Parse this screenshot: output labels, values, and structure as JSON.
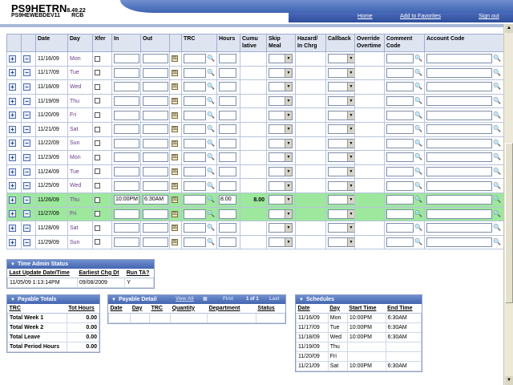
{
  "header": {
    "title": "PS9HETRN",
    "version": "8.49.22",
    "db": "PS9HEWEBDEV11",
    "user": "RCB",
    "links": {
      "home": "Home",
      "favorites": "Add to Favorites",
      "signout": "Sign out"
    }
  },
  "timesheet": {
    "columns": {
      "date": "Date",
      "day": "Day",
      "xfer": "Xfer",
      "in": "In",
      "out": "Out",
      "trc": "TRC",
      "hours": "Hours",
      "cumulative": "Cumu lative",
      "skip_meal": "Skip Meal",
      "hazard": "Hazard/ In Chrg",
      "callback": "Callback",
      "override": "Override Overtime",
      "comment_code": "Comment Code",
      "account_code": "Account Code"
    },
    "add_glyph": "+",
    "delete_glyph": "−",
    "rows": [
      {
        "date": "11/16/09",
        "day": "Mon",
        "in": "",
        "out": "",
        "trc": "",
        "hours": "",
        "cumulative": ""
      },
      {
        "date": "11/17/09",
        "day": "Tue",
        "in": "",
        "out": "",
        "trc": "",
        "hours": "",
        "cumulative": ""
      },
      {
        "date": "11/18/09",
        "day": "Wed",
        "in": "",
        "out": "",
        "trc": "",
        "hours": "",
        "cumulative": ""
      },
      {
        "date": "11/19/09",
        "day": "Thu",
        "in": "",
        "out": "",
        "trc": "",
        "hours": "",
        "cumulative": ""
      },
      {
        "date": "11/20/09",
        "day": "Fri",
        "in": "",
        "out": "",
        "trc": "",
        "hours": "",
        "cumulative": ""
      },
      {
        "date": "11/21/09",
        "day": "Sat",
        "in": "",
        "out": "",
        "trc": "",
        "hours": "",
        "cumulative": ""
      },
      {
        "date": "11/22/09",
        "day": "Sun",
        "in": "",
        "out": "",
        "trc": "",
        "hours": "",
        "cumulative": ""
      },
      {
        "date": "11/23/09",
        "day": "Mon",
        "in": "",
        "out": "",
        "trc": "",
        "hours": "",
        "cumulative": ""
      },
      {
        "date": "11/24/09",
        "day": "Tue",
        "in": "",
        "out": "",
        "trc": "",
        "hours": "",
        "cumulative": ""
      },
      {
        "date": "11/25/09",
        "day": "Wed",
        "in": "",
        "out": "",
        "trc": "",
        "hours": "",
        "cumulative": ""
      },
      {
        "date": "11/26/09",
        "day": "Thu",
        "in": "10:00PM",
        "out": "6:30AM",
        "trc": "",
        "hours": "8.00",
        "cumulative": "8.00"
      },
      {
        "date": "11/27/09",
        "day": "Fri",
        "in": "",
        "out": "",
        "trc": "",
        "hours": "",
        "cumulative": ""
      },
      {
        "date": "11/28/09",
        "day": "Sat",
        "in": "",
        "out": "",
        "trc": "",
        "hours": "",
        "cumulative": ""
      },
      {
        "date": "11/29/09",
        "day": "Sun",
        "in": "",
        "out": "",
        "trc": "",
        "hours": "",
        "cumulative": ""
      }
    ]
  },
  "time_admin_status": {
    "title": "Time Admin Status",
    "headers": [
      "Last Update Date/Time",
      "Earliest Chg Dt",
      "Run TA?"
    ],
    "row": [
      "11/05/09  1:13:14PM",
      "09/08/2009",
      "Y"
    ]
  },
  "payable_totals": {
    "title": "Payable Totals",
    "headers": [
      "TRC",
      "Tot Hours"
    ],
    "rows": [
      [
        "Total Week 1",
        "0.00"
      ],
      [
        "Total Week 2",
        "0.00"
      ],
      [
        "Total Leave",
        "0.00"
      ],
      [
        "Total Period Hours",
        "0.00"
      ]
    ]
  },
  "payable_detail": {
    "title": "Payable Detail",
    "view_all": "View All",
    "first": "First",
    "range": "1 of 1",
    "last": "Last",
    "headers": [
      "Date",
      "Day",
      "TRC",
      "Quantity",
      "Department",
      "Status"
    ]
  },
  "schedules": {
    "title": "Schedules",
    "headers": [
      "Date",
      "Day",
      "Start Time",
      "End Time"
    ],
    "rows": [
      [
        "11/16/09",
        "Mon",
        "10:00PM",
        "6:30AM"
      ],
      [
        "11/17/09",
        "Tue",
        "10:00PM",
        "6:30AM"
      ],
      [
        "11/18/09",
        "Wed",
        "10:00PM",
        "6:30AM"
      ],
      [
        "11/19/09",
        "Thu",
        "",
        ""
      ],
      [
        "11/20/09",
        "Fri",
        "",
        ""
      ],
      [
        "11/21/09",
        "Sat",
        "10:00PM",
        "6:30AM"
      ]
    ]
  }
}
